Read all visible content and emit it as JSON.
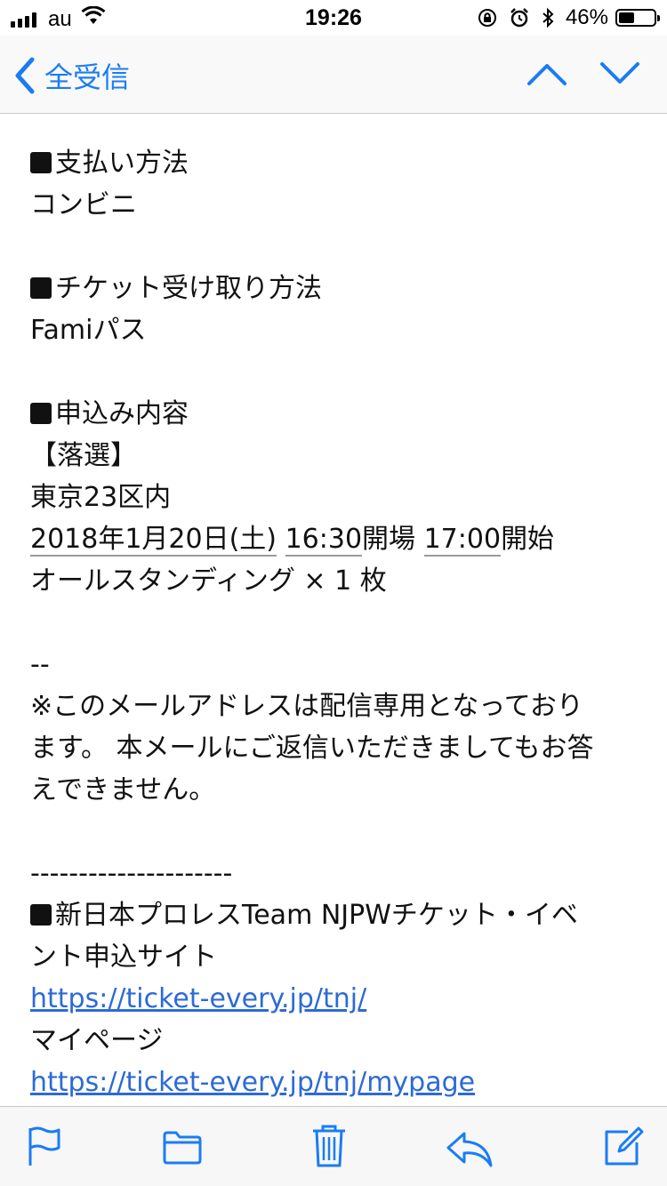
{
  "status_bar": {
    "carrier": "au",
    "time": "19:26",
    "battery": "46%",
    "battery_level": 0.46
  },
  "nav": {
    "back_label": "全受信",
    "accent_color": "#1a7cf5"
  },
  "email": {
    "payment_header": "支払い方法",
    "payment_value": "コンビニ",
    "ticket_header": "チケット受け取り方法",
    "ticket_value": "Famiパス",
    "application_header": "申込み内容",
    "result": "【落選】",
    "venue": "東京23区内",
    "date": "2018年1月20日(土)",
    "open_time": "16:30",
    "open_label": "開場",
    "start_time": "17:00",
    "start_label": "開始",
    "seat": "オールスタンディング × 1 枚",
    "separator_short": "--",
    "notice_line1": "※このメールアドレスは配信専用となっており",
    "notice_line2": "ます。 本メールにご返信いただきましてもお答",
    "notice_line3": "えできません。",
    "separator_long": "---------------------",
    "site_line1": "新日本プロレスTeam NJPWチケット・イベ",
    "site_line2": "ント申込サイト",
    "site_url": "https://ticket-every.jp/tnj/",
    "mypage_label": "マイページ",
    "mypage_url": "https://ticket-every.jp/tnj/mypage"
  },
  "toolbar": {
    "icons": [
      "flag-icon",
      "folder-icon",
      "trash-icon",
      "reply-icon",
      "compose-icon"
    ]
  }
}
